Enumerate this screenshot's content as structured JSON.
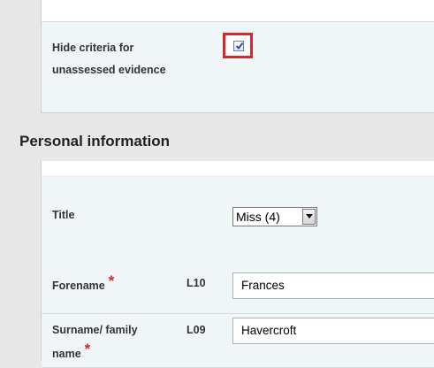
{
  "hide_criteria": {
    "label": "Hide criteria for unassessed evidence",
    "checked": true
  },
  "personal_information": {
    "heading": "Personal information",
    "title_field": {
      "label": "Title",
      "selected": "Miss (4)"
    },
    "forename_field": {
      "label": "Forename",
      "required_mark": "*",
      "code": "L10",
      "value": "Frances"
    },
    "surname_field": {
      "label": "Surname/ family name",
      "required_mark": "*",
      "code": "L09",
      "value": "Havercroft"
    }
  },
  "colors": {
    "highlight": "#d8272b",
    "required": "#d8272b",
    "panel_bg": "#f0f5f8"
  }
}
